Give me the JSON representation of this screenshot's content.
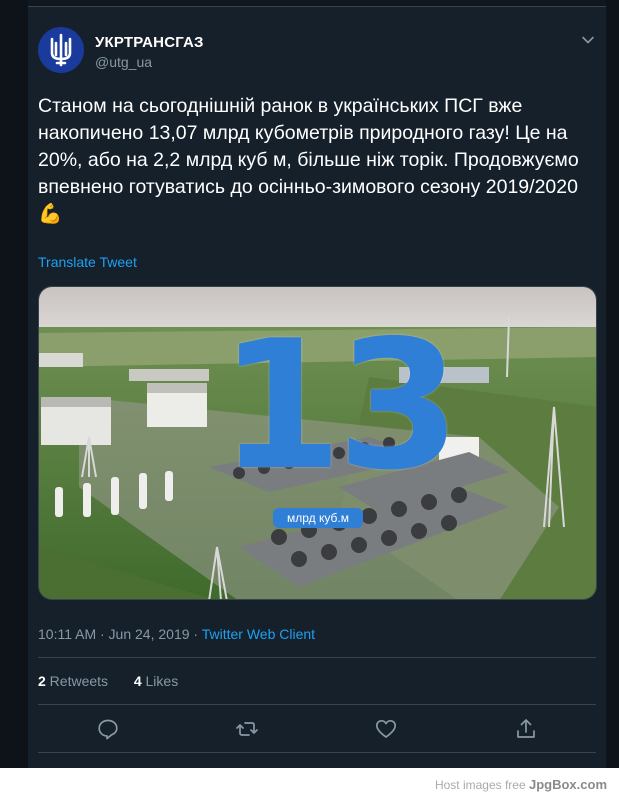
{
  "account": {
    "name": "УКРТРАНСГАЗ",
    "handle": "@utg_ua",
    "avatar_icon": "trident-logo-icon"
  },
  "tweet": {
    "text": "Станом на сьогоднішній ранок в українських ПСГ вже накопичено 13,07 млрд кубометрів природного газу! Це на 20%, або на 2,2 млрд куб м, більше ніж торік. Продовжуємо впевнено готуватись до осінньо-зимового сезону 2019/2020 💪",
    "translate_label": "Translate Tweet",
    "image": {
      "number": "13",
      "unit": "млрд куб.м"
    },
    "time": "10:11 AM · Jun 24, 2019 · ",
    "client": "Twitter Web Client"
  },
  "stats": {
    "retweets_count": "2",
    "retweets_label": " Retweets",
    "likes_count": "4",
    "likes_label": " Likes"
  },
  "actions": [
    {
      "icon": "reply-icon"
    },
    {
      "icon": "retweet-icon"
    },
    {
      "icon": "like-icon"
    },
    {
      "icon": "share-icon"
    }
  ],
  "footer": {
    "text": "Host images free ",
    "brand": "JpgBox.com"
  },
  "colors": {
    "background": "#15202b",
    "accent": "#1da1f2",
    "muted": "#8899a6",
    "number_blue": "#2f7fd6"
  }
}
